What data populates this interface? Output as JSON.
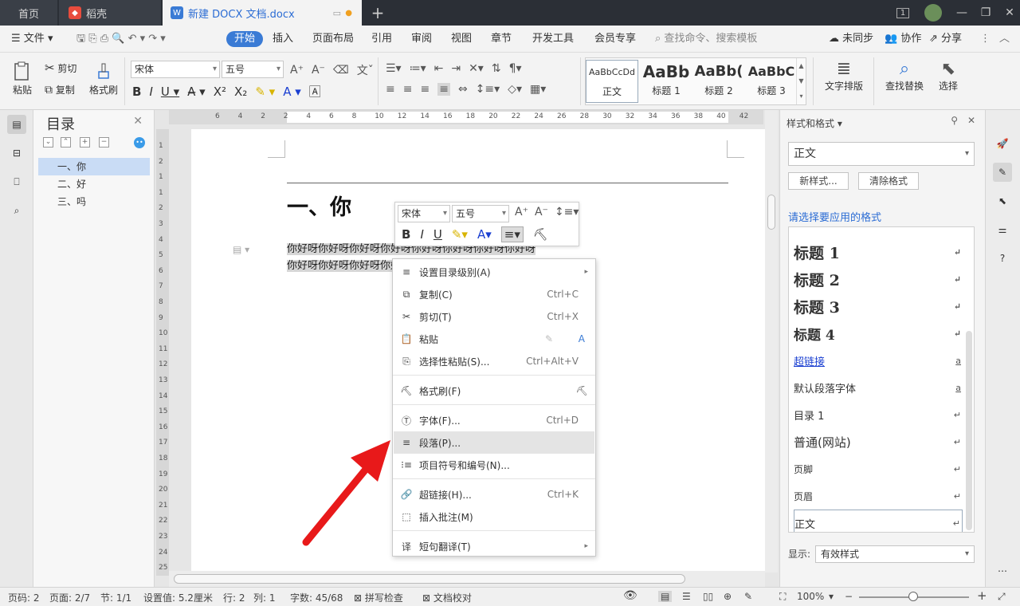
{
  "titlebar": {
    "tab_home": "首页",
    "tab_daoke": "稻壳",
    "tab_doc": "新建 DOCX 文档.docx",
    "badge": "1"
  },
  "menu": {
    "file": "文件",
    "items": [
      "开始",
      "插入",
      "页面布局",
      "引用",
      "审阅",
      "视图",
      "章节",
      "开发工具",
      "会员专享"
    ],
    "search": "查找命令、搜索模板",
    "sync": "未同步",
    "collab": "协作",
    "share": "分享"
  },
  "ribbon": {
    "paste": "粘贴",
    "cut": "剪切",
    "copy": "复制",
    "format_painter": "格式刷",
    "font_name": "宋体",
    "font_size": "五号",
    "styles": [
      {
        "preview": "AaBbCcDd",
        "label": "正文"
      },
      {
        "preview": "AaBb",
        "label": "标题 1"
      },
      {
        "preview": "AaBb(",
        "label": "标题 2"
      },
      {
        "preview": "AaBbC",
        "label": "标题 3"
      }
    ],
    "text_layout": "文字排版",
    "find_replace": "查找替换",
    "select": "选择"
  },
  "toc": {
    "title": "目录",
    "items": [
      "一、你",
      "二、好",
      "三、吗"
    ]
  },
  "ruler": {
    "top": [
      "6",
      "4",
      "2",
      "2",
      "4",
      "6",
      "8",
      "10",
      "12",
      "14",
      "16",
      "18",
      "20",
      "22",
      "24",
      "26",
      "28",
      "30",
      "32",
      "34",
      "36",
      "38",
      "40",
      "42"
    ],
    "left": [
      "1",
      "2",
      "1",
      "1",
      "2",
      "3",
      "4",
      "5",
      "6",
      "7",
      "8",
      "9",
      "10",
      "11",
      "12",
      "13",
      "14",
      "15",
      "16",
      "17",
      "18",
      "19",
      "20",
      "21",
      "22",
      "23",
      "24",
      "25"
    ]
  },
  "document": {
    "heading": "一、你",
    "line1": "你好呀你好呀你好呀你好呀你好呀你好呀你好呀你好呀",
    "line2": "你好呀你好呀你好呀你好呀"
  },
  "mini_toolbar": {
    "font_name": "宋体",
    "font_size": "五号"
  },
  "context_menu": [
    {
      "label": "设置目录级别(A)",
      "shortcut": "",
      "submenu": true
    },
    {
      "label": "复制(C)",
      "shortcut": "Ctrl+C"
    },
    {
      "label": "剪切(T)",
      "shortcut": "Ctrl+X"
    },
    {
      "label": "粘贴",
      "shortcut": ""
    },
    {
      "label": "选择性粘贴(S)...",
      "shortcut": "Ctrl+Alt+V"
    },
    {
      "label": "格式刷(F)",
      "shortcut": ""
    },
    {
      "label": "字体(F)...",
      "shortcut": "Ctrl+D"
    },
    {
      "label": "段落(P)...",
      "shortcut": ""
    },
    {
      "label": "项目符号和编号(N)...",
      "shortcut": ""
    },
    {
      "label": "超链接(H)...",
      "shortcut": "Ctrl+K"
    },
    {
      "label": "插入批注(M)",
      "shortcut": ""
    },
    {
      "label": "短句翻译(T)",
      "shortcut": "",
      "submenu": true
    }
  ],
  "styles_pane": {
    "title": "样式和格式",
    "current": "正文",
    "new_style": "新样式...",
    "clear_format": "清除格式",
    "apply_label": "请选择要应用的格式",
    "items": [
      {
        "name": "标题 1",
        "mark": "↵"
      },
      {
        "name": "标题 2",
        "mark": "↵"
      },
      {
        "name": "标题 3",
        "mark": "↵"
      },
      {
        "name": "标题 4",
        "mark": "↵"
      },
      {
        "name": "超链接",
        "mark": "a"
      },
      {
        "name": "默认段落字体",
        "mark": "a"
      },
      {
        "name": "目录 1",
        "mark": "↵"
      },
      {
        "name": "普通(网站)",
        "mark": "↵"
      },
      {
        "name": "页脚",
        "mark": "↵"
      },
      {
        "name": "页眉",
        "mark": "↵"
      },
      {
        "name": "正文",
        "mark": "↵"
      }
    ],
    "show_label": "显示:",
    "show_value": "有效样式"
  },
  "statusbar": {
    "page_num": "页码: 2",
    "pages": "页面: 2/7",
    "section": "节: 1/1",
    "setting": "设置值: 5.2厘米",
    "row": "行: 2",
    "col": "列: 1",
    "words": "字数: 45/68",
    "spell": "拼写检查",
    "proof": "文档校对",
    "zoom": "100%"
  },
  "colors": {
    "accent": "#3a7bd5",
    "arrow": "#e8191a",
    "titlebar": "#2b2f36"
  }
}
